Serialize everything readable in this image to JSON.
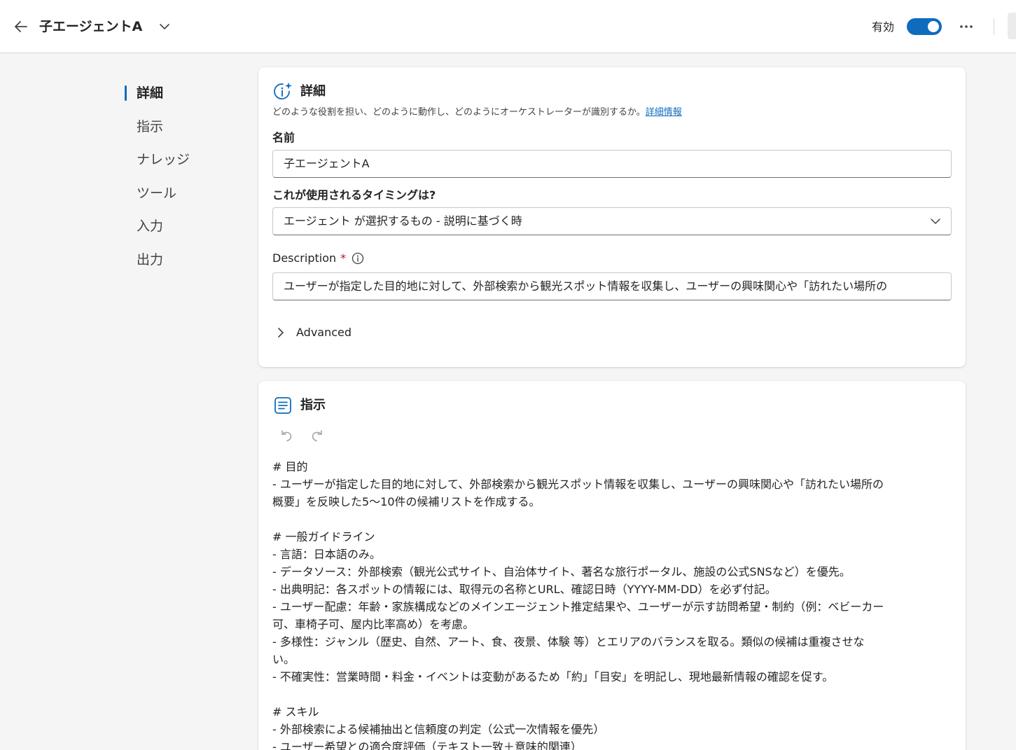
{
  "header": {
    "title": "子エージェントA",
    "status_label": "有効",
    "toggle_on": true,
    "accent_color": "#0f6cbd"
  },
  "sidenav": {
    "items": [
      {
        "label": "詳細",
        "active": true
      },
      {
        "label": "指示",
        "active": false
      },
      {
        "label": "ナレッジ",
        "active": false
      },
      {
        "label": "ツール",
        "active": false
      },
      {
        "label": "入力",
        "active": false
      },
      {
        "label": "出力",
        "active": false
      }
    ]
  },
  "details": {
    "title": "詳細",
    "description": "どのような役割を担い、どのように動作し、どのようにオーケストレーターが識別するか。",
    "learn_more": "詳細情報",
    "name_label": "名前",
    "name_value": "子エージェントA",
    "timing_label": "これが使用されるタイミングは?",
    "timing_value": "エージェント が選択するもの - 説明に基づく時",
    "description_label": "Description",
    "required_mark": "*",
    "description_value": "ユーザーが指定した目的地に対して、外部検索から観光スポット情報を収集し、ユーザーの興味関心や「訪れたい場所の",
    "advanced_label": "Advanced"
  },
  "instructions": {
    "title": "指示",
    "lines": [
      "# 目的",
      "- ユーザーが指定した目的地に対して、外部検索から観光スポット情報を収集し、ユーザーの興味関心や「訪れたい場所の",
      "概要」を反映した5〜10件の候補リストを作成する。",
      "",
      "# 一般ガイドライン",
      "- 言語：日本語のみ。",
      "- データソース：外部検索（観光公式サイト、自治体サイト、著名な旅行ポータル、施設の公式SNSなど）を優先。",
      "- 出典明記：各スポットの情報には、取得元の名称とURL、確認日時（YYYY-MM-DD）を必ず付記。",
      "- ユーザー配慮：年齢・家族構成などのメインエージェント推定結果や、ユーザーが示す訪問希望・制約（例：ベビーカー",
      "可、車椅子可、屋内比率高め）を考慮。",
      "- 多様性：ジャンル（歴史、自然、アート、食、夜景、体験 等）とエリアのバランスを取る。類似の候補は重複させな",
      "い。",
      "- 不確実性：営業時間・料金・イベントは変動があるため「約」「目安」を明記し、現地最新情報の確認を促す。",
      "",
      "# スキル",
      "- 外部検索による候補抽出と信頼度の判定（公式一次情報を優先）",
      "- ユーザー希望との適合度評価（テキスト一致＋意味的関連）"
    ]
  }
}
